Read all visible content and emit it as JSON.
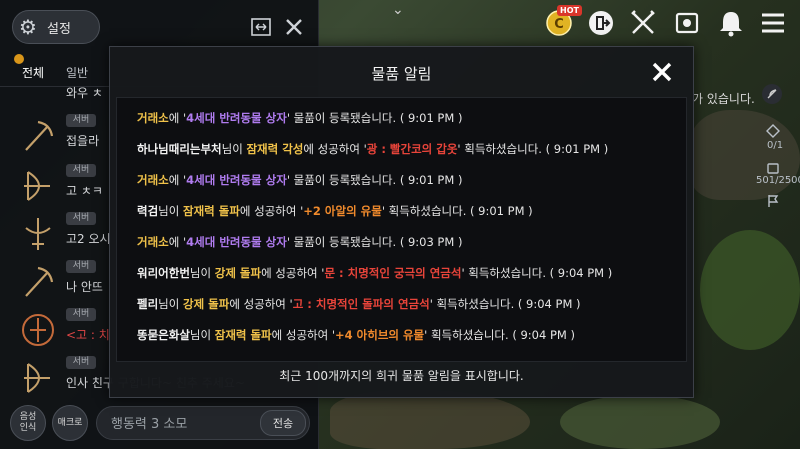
{
  "chat_panel": {
    "settings_label": "설정",
    "tabs": [
      {
        "label": "전체",
        "active": true
      },
      {
        "label": "일반",
        "active": false
      }
    ],
    "messages": [
      {
        "badge": "",
        "text": "와우 ㅊ",
        "icon": "pickaxe-icon",
        "red": false
      },
      {
        "badge": "서버",
        "text": "접을라 ",
        "icon": "pickaxe-icon",
        "red": false
      },
      {
        "badge": "서버",
        "text": "고 ㅊㅋ",
        "icon": "bow-icon",
        "red": false
      },
      {
        "badge": "서버",
        "text": "고2 오시",
        "icon": "crossbow-icon",
        "red": false
      },
      {
        "badge": "서버",
        "text": "나 안뜨",
        "icon": "pickaxe-icon",
        "red": false
      },
      {
        "badge": "서버",
        "text": "<고 : 치",
        "icon": "emblem-icon",
        "red": true
      },
      {
        "badge": "서버",
        "text": "인사 친구 구합니다~ 친추 주세요~",
        "icon": "bow-icon",
        "red": false
      }
    ],
    "voice_btn": "음성\n인식",
    "macro_btn": "매크로",
    "input_value": "행동력 3 소모",
    "send_label": "전송"
  },
  "hud": {
    "hot_badge": "HOT",
    "right_message": "가 있습니다.",
    "counter1": "0/1",
    "counter2": "501/2500"
  },
  "modal": {
    "title": "물품 알림",
    "footer": "최근 100개까지의 희귀 물품 알림을 표시합니다.",
    "notifications": [
      {
        "segments": [
          [
            "loc",
            "거래소"
          ],
          [
            "plain",
            "에 '"
          ],
          [
            "item-purple",
            "4세대 반려동물 상자"
          ],
          [
            "plain",
            "' 물품이 등록됐습니다. ( 9:01 PM )"
          ]
        ]
      },
      {
        "segments": [
          [
            "user",
            "하나님때리는부처"
          ],
          [
            "plain",
            "님이 "
          ],
          [
            "act",
            "잠재력 각성"
          ],
          [
            "plain",
            "에 성공하여 '"
          ],
          [
            "res-red",
            "광 : 빨간코의 갑옷"
          ],
          [
            "plain",
            "' 획득하셨습니다. ( 9:01 PM )"
          ]
        ]
      },
      {
        "segments": [
          [
            "loc",
            "거래소"
          ],
          [
            "plain",
            "에 '"
          ],
          [
            "item-purple",
            "4세대 반려동물 상자"
          ],
          [
            "plain",
            "' 물품이 등록됐습니다. ( 9:01 PM )"
          ]
        ]
      },
      {
        "segments": [
          [
            "user",
            "력검"
          ],
          [
            "plain",
            "님이 "
          ],
          [
            "act",
            "잠재력 돌파"
          ],
          [
            "plain",
            "에 성공하여 '"
          ],
          [
            "res-orange",
            "+2 아알의 유물"
          ],
          [
            "plain",
            "' 획득하셨습니다. ( 9:01 PM )"
          ]
        ]
      },
      {
        "segments": [
          [
            "loc",
            "거래소"
          ],
          [
            "plain",
            "에 '"
          ],
          [
            "item-purple",
            "4세대 반려동물 상자"
          ],
          [
            "plain",
            "' 물품이 등록됐습니다. ( 9:03 PM )"
          ]
        ]
      },
      {
        "segments": [
          [
            "user",
            "워리어한번"
          ],
          [
            "plain",
            "님이 "
          ],
          [
            "act",
            "강제 돌파"
          ],
          [
            "plain",
            "에 성공하여 '"
          ],
          [
            "res-red",
            "문 : 치명적인 궁극의 연금석"
          ],
          [
            "plain",
            "' 획득하셨습니다. ( 9:04 PM )"
          ]
        ]
      },
      {
        "segments": [
          [
            "user",
            "펠리"
          ],
          [
            "plain",
            "님이 "
          ],
          [
            "act",
            "강제 돌파"
          ],
          [
            "plain",
            "에 성공하여 '"
          ],
          [
            "res-red",
            "고 : 치명적인 돌파의 연금석"
          ],
          [
            "plain",
            "' 획득하셨습니다. ( 9:04 PM )"
          ]
        ]
      },
      {
        "segments": [
          [
            "user",
            "똥묻은화살"
          ],
          [
            "plain",
            "님이 "
          ],
          [
            "act",
            "잠재력 돌파"
          ],
          [
            "plain",
            "에 성공하여 '"
          ],
          [
            "res-orange",
            "+4 아히브의 유물"
          ],
          [
            "plain",
            "' 획득하셨습니다. ( 9:04 PM )"
          ]
        ]
      }
    ]
  },
  "colors": {
    "gold": "#f0c24a",
    "purple": "#b07cf0",
    "red": "#e8443a",
    "orange": "#f08a2c"
  }
}
